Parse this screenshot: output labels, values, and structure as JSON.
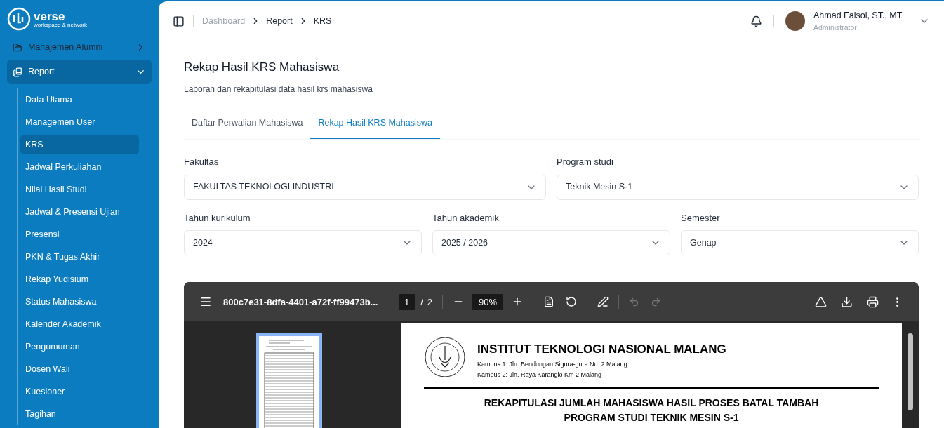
{
  "sidebar": {
    "logo": {
      "main": "verse",
      "tagline": "workspace & network"
    },
    "items": [
      {
        "label": "Manajemen Alumni",
        "expanded": false
      },
      {
        "label": "Report",
        "expanded": true,
        "children": [
          {
            "label": "Data Utama",
            "selected": false
          },
          {
            "label": "Managemen User",
            "selected": false
          },
          {
            "label": "KRS",
            "selected": true
          },
          {
            "label": "Jadwal Perkuliahan",
            "selected": false
          },
          {
            "label": "Nilai Hasil Studi",
            "selected": false
          },
          {
            "label": "Jadwal & Presensi Ujian",
            "selected": false
          },
          {
            "label": "Presensi",
            "selected": false
          },
          {
            "label": "PKN & Tugas Akhir",
            "selected": false
          },
          {
            "label": "Rekap Yudisium",
            "selected": false
          },
          {
            "label": "Status Mahasiswa",
            "selected": false
          },
          {
            "label": "Kalender Akademik",
            "selected": false
          },
          {
            "label": "Pengumuman",
            "selected": false
          },
          {
            "label": "Dosen Wali",
            "selected": false
          },
          {
            "label": "Kuesioner",
            "selected": false
          },
          {
            "label": "Tagihan",
            "selected": false
          }
        ]
      }
    ]
  },
  "breadcrumb": [
    "Dashboard",
    "Report",
    "KRS"
  ],
  "user": {
    "name": "Ahmad Faisol, ST., MT",
    "role": "Administrator"
  },
  "page": {
    "title": "Rekap Hasil KRS Mahasiswa",
    "subtitle": "Laporan dan rekapitulasi data hasil krs mahasiswa"
  },
  "tabs": [
    {
      "label": "Daftar Perwalian Mahasiswa",
      "selected": false
    },
    {
      "label": "Rekap Hasil KRS Mahasiswa",
      "selected": true
    }
  ],
  "filters": [
    [
      {
        "label": "Fakultas",
        "value": "FAKULTAS TEKNOLOGI INDUSTRI"
      },
      {
        "label": "Program studi",
        "value": "Teknik Mesin S-1"
      }
    ],
    [
      {
        "label": "Tahun kurikulum",
        "value": "2024"
      },
      {
        "label": "Tahun akademik",
        "value": "2025 / 2026"
      },
      {
        "label": "Semester",
        "value": "Genap"
      }
    ]
  ],
  "pdf_viewer": {
    "filename": "800c7e31-8dfa-4401-a72f-ff99473b...",
    "page": "1",
    "page_separator": "/",
    "page_count": "2",
    "zoom": "90%",
    "document": {
      "institution": "INSTITUT TEKNOLOGI NASIONAL MALANG",
      "campus_lines": [
        "Kampus 1: Jln. Bendungan Sigura-gura No. 2 Malang",
        "Kampus 2: Jln. Raya Karanglo Km 2 Malang"
      ],
      "heading_lines": [
        "REKAPITULASI JUMLAH MAHASISWA HASIL PROSES BATAL TAMBAH",
        "PROGRAM STUDI TEKNIK MESIN S-1"
      ]
    }
  }
}
